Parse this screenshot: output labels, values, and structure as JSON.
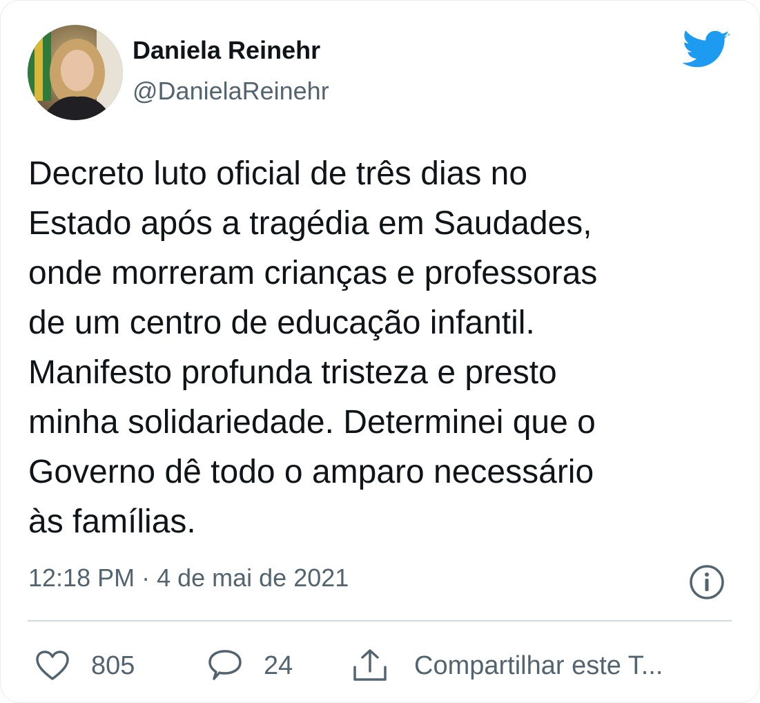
{
  "tweet": {
    "author_name": "Daniela Reinehr",
    "author_handle": "@DanielaReinehr",
    "text_lines": [
      "Decreto luto oficial de três dias no",
      "Estado após a tragédia em Saudades,",
      "onde morreram crianças e professoras",
      "de um centro de educação infantil.",
      "Manifesto profunda tristeza e presto",
      "minha solidariedade. Determinei que o",
      "Governo dê todo o amparo necessário",
      "às famílias."
    ],
    "timestamp": "12:18 PM · 4 de mai de 2021"
  },
  "actions": {
    "like_count": "805",
    "reply_count": "24",
    "share_label": "Compartilhar este T..."
  },
  "icons": {
    "brand": "twitter-bird-icon",
    "info": "info-icon",
    "like": "heart-icon",
    "reply": "speech-bubble-icon",
    "share": "share-icon"
  },
  "colors": {
    "twitter_blue": "#1d9bf0",
    "text_primary": "#0f1419",
    "text_secondary": "#536471",
    "divider": "#cfd9de"
  }
}
